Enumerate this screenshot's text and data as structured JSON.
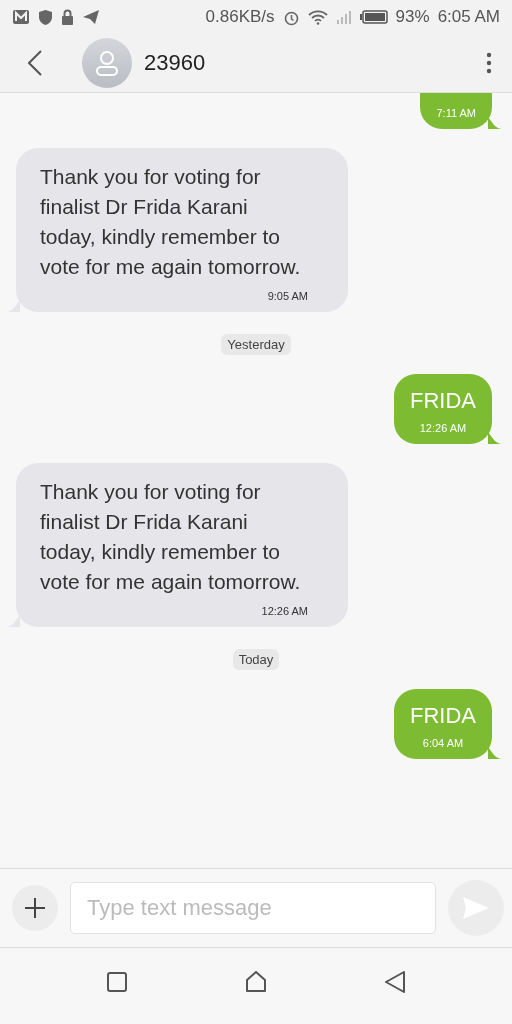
{
  "status_bar": {
    "speed": "0.86KB/s",
    "battery": "93%",
    "time": "6:05 AM"
  },
  "header": {
    "title": "23960"
  },
  "messages": [
    {
      "kind": "outgoing",
      "time": "7:11 AM"
    },
    {
      "kind": "incoming",
      "text": "Thank you for voting for finalist Dr Frida Karani today, kindly remember to vote for me again tomorrow.",
      "time": "9:05 AM"
    },
    {
      "kind": "date",
      "text": "Yesterday"
    },
    {
      "kind": "outgoing",
      "text": "FRIDA",
      "time": "12:26 AM"
    },
    {
      "kind": "incoming",
      "text": "Thank you for voting for finalist Dr Frida Karani today, kindly remember to vote for me again tomorrow.",
      "time": "12:26 AM"
    },
    {
      "kind": "date",
      "text": "Today"
    },
    {
      "kind": "outgoing",
      "text": "FRIDA",
      "time": "6:04 AM"
    }
  ],
  "composer": {
    "placeholder": "Type text message"
  }
}
